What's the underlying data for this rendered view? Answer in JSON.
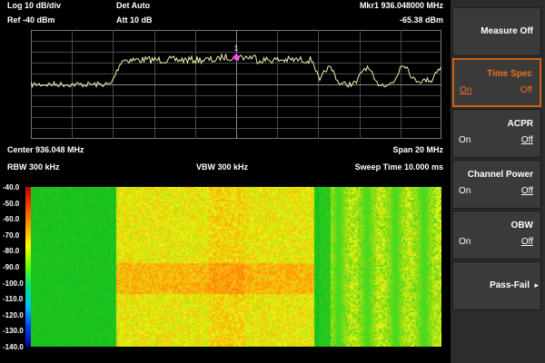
{
  "status": {
    "scale": "Log 10 dB/div",
    "ref": "Ref -40 dBm",
    "detector": "Det Auto",
    "attenuation": "Att 10 dB",
    "marker_freq": "Mkr1  936.048000 MHz",
    "marker_level": "-65.38 dBm",
    "marker_label": "1"
  },
  "bottom_info": {
    "center": "Center 936.048 MHz",
    "span": "Span 20 MHz",
    "rbw": "RBW 300 kHz",
    "vbw": "VBW 300 kHz",
    "sweep": "Sweep Time 10.000 ms"
  },
  "waterfall": {
    "scale_labels": [
      "-40.0",
      "-50.0",
      "-60.0",
      "-70.0",
      "-80.0",
      "-90.0",
      "-100.0",
      "-110.0",
      "-120.0",
      "-130.0",
      "-140.0"
    ]
  },
  "softkeys": [
    {
      "title": "Measure Off"
    },
    {
      "title": "Time Spec",
      "on": "On",
      "off": "Off"
    },
    {
      "title": "ACPR",
      "on": "On",
      "off": "Off"
    },
    {
      "title": "Channel Power",
      "on": "On",
      "off": "Off"
    },
    {
      "title": "OBW",
      "on": "On",
      "off": "Off"
    },
    {
      "title": "Pass-Fail",
      "arrow": "▸"
    }
  ],
  "colors": {
    "trace": "#f0f0b0",
    "marker": "#ff40ff",
    "active_border": "#d06010",
    "active_text": "#f07020",
    "grid": "#4a4a4a"
  }
}
